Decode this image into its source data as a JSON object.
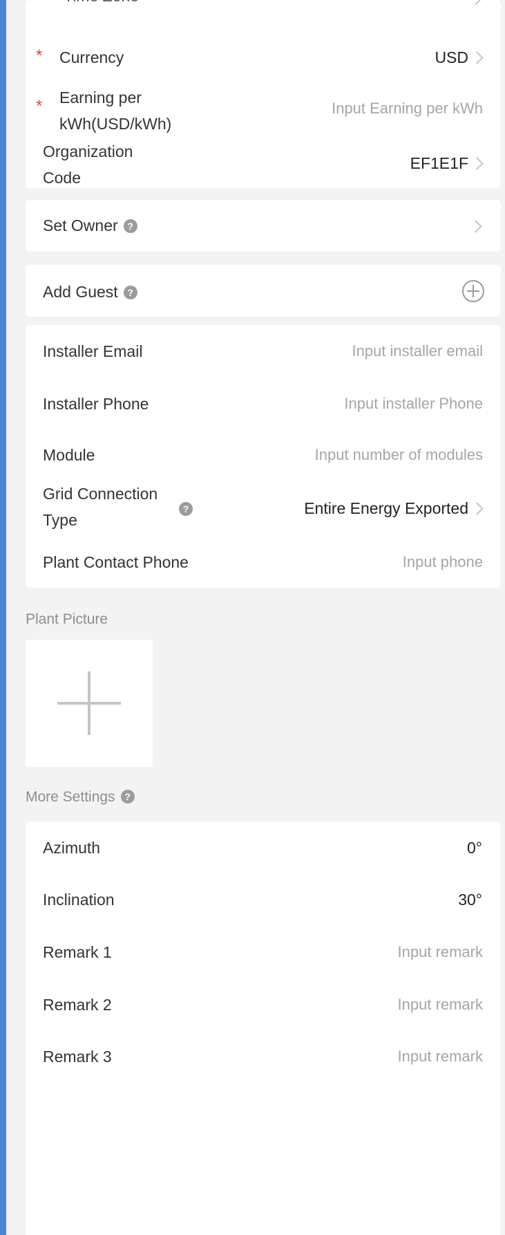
{
  "top_row": {
    "label": "Time Zone"
  },
  "basic": {
    "currency": {
      "label": "Currency",
      "value": "USD",
      "required_mark": "*"
    },
    "earning": {
      "label_line1": "Earning per",
      "label_line2": "kWh(USD/kWh)",
      "placeholder": "Input Earning per kWh",
      "required_mark": "*"
    },
    "org_code": {
      "label_line1": "Organization",
      "label_line2": "Code",
      "value": "EF1E1F"
    }
  },
  "set_owner": {
    "label": "Set Owner"
  },
  "add_guest": {
    "label": "Add Guest"
  },
  "installer": {
    "email": {
      "label": "Installer Email",
      "placeholder": "Input installer email"
    },
    "phone": {
      "label": "Installer Phone",
      "placeholder": "Input installer Phone"
    },
    "module": {
      "label": "Module",
      "placeholder": "Input number of modules"
    },
    "grid": {
      "label_line1": "Grid Connection",
      "label_line2": "Type",
      "value": "Entire Energy Exported"
    },
    "contact": {
      "label": "Plant Contact Phone",
      "placeholder": "Input phone"
    }
  },
  "plant_picture": {
    "title": "Plant Picture"
  },
  "more_settings": {
    "title": "More Settings",
    "azimuth": {
      "label": "Azimuth",
      "value": "0°"
    },
    "inclination": {
      "label": "Inclination",
      "value": "30°"
    },
    "remark1": {
      "label": "Remark 1",
      "placeholder": "Input remark"
    },
    "remark2": {
      "label": "Remark 2",
      "placeholder": "Input remark"
    },
    "remark3": {
      "label": "Remark 3",
      "placeholder": "Input remark"
    }
  },
  "colors": {
    "accent_bar": "#4a86d8",
    "required": "#e04646",
    "background": "#f3f3f4"
  },
  "help_icon_glyph": "?"
}
